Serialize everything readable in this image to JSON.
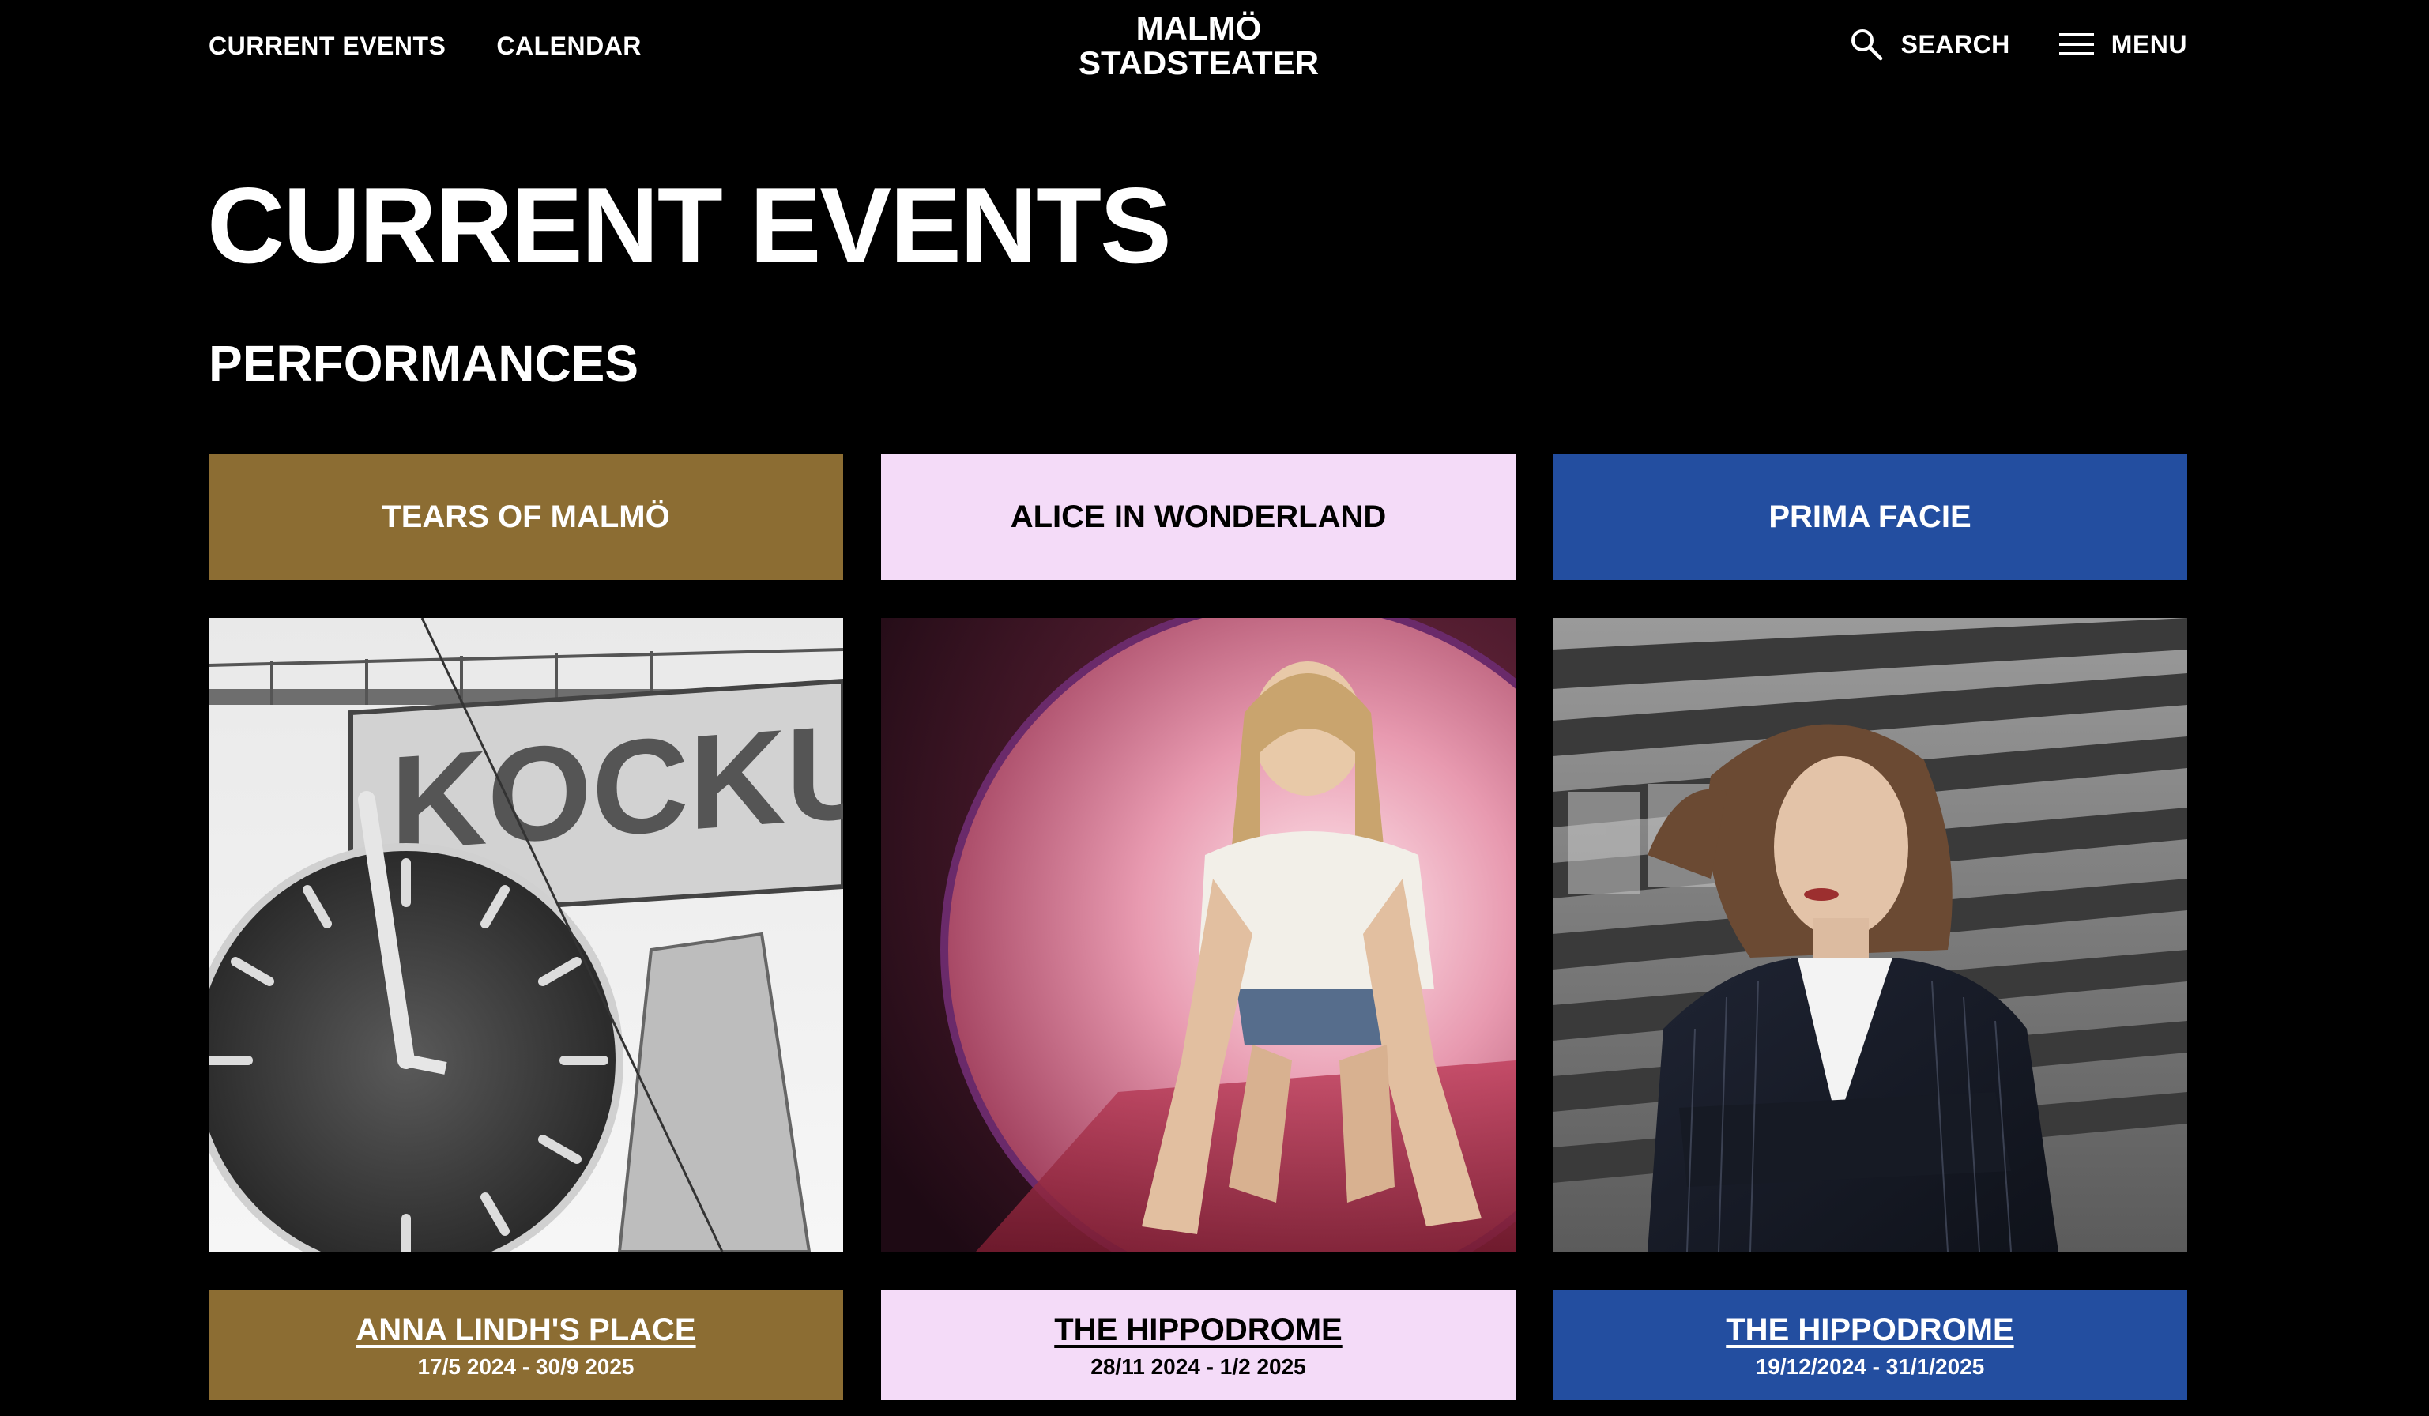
{
  "nav": {
    "left_links": [
      "CURRENT EVENTS",
      "CALENDAR"
    ],
    "logo_line1": "MALMÖ",
    "logo_line2": "STADSTEATER",
    "search_label": "SEARCH",
    "menu_label": "MENU",
    "search_icon": "search-icon",
    "menu_icon": "hamburger-menu-icon"
  },
  "page": {
    "title": "CURRENT EVENTS",
    "section": "PERFORMANCES"
  },
  "performances": [
    {
      "title": "TEARS OF MALMÖ",
      "venue": "ANNA LINDH'S PLACE",
      "dates": "17/5 2024 -  30/9 2025",
      "color": "#8c6d33",
      "image": "clock-and-kockums-crane-photo"
    },
    {
      "title": "ALICE IN WONDERLAND",
      "venue": "THE HIPPODROME",
      "dates": "28/11 2024 -  1/2 2025",
      "color": "#f4dbf8",
      "image": "girl-crawling-through-pink-tunnel-photo"
    },
    {
      "title": "PRIMA FACIE",
      "venue": "THE HIPPODROME",
      "dates": "19/12/2024 -  31/1/2025",
      "color": "#234ea0",
      "image": "woman-in-pinstripe-suit-photo"
    }
  ],
  "colors": {
    "background": "#000000",
    "text": "#ffffff"
  }
}
